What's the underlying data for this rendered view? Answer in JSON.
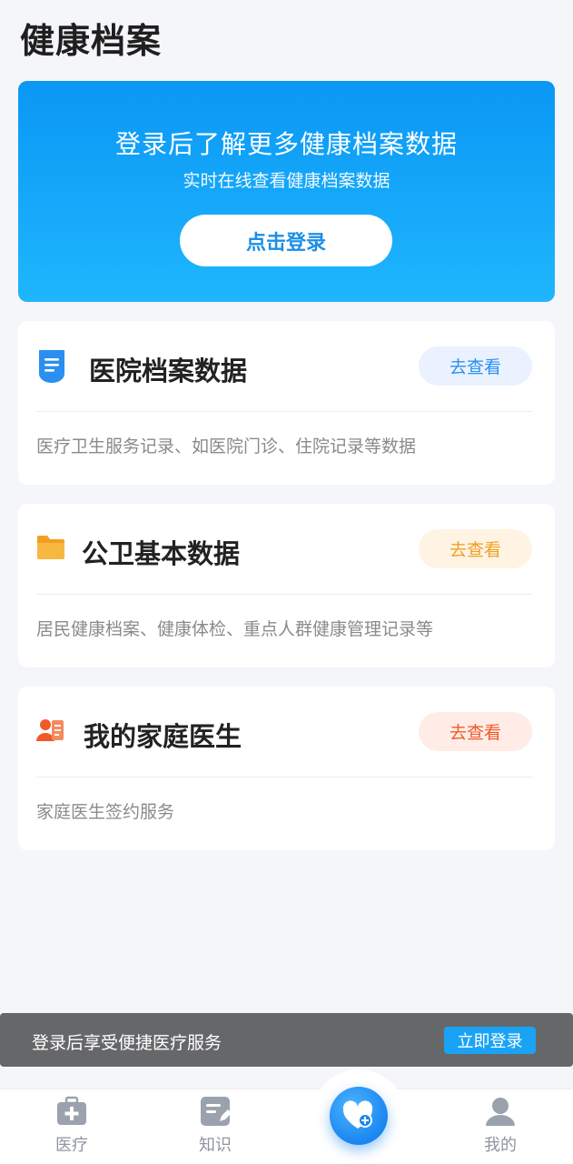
{
  "page": {
    "title": "健康档案"
  },
  "banner": {
    "title": "登录后了解更多健康档案数据",
    "subtitle": "实时在线查看健康档案数据",
    "button_label": "点击登录"
  },
  "cards": [
    {
      "title": "医院档案数据",
      "button_label": "去查看",
      "description": "医疗卫生服务记录、如医院门诊、住院记录等数据",
      "icon": "document-icon",
      "accent": "#2a8ff0",
      "button_bg": "#e9f2fe"
    },
    {
      "title": "公卫基本数据",
      "button_label": "去查看",
      "description": "居民健康档案、健康体检、重点人群健康管理记录等",
      "icon": "folder-icon",
      "accent": "#f0a020",
      "button_bg": "#fff3e3"
    },
    {
      "title": "我的家庭医生",
      "button_label": "去查看",
      "description": "家庭医生签约服务",
      "icon": "doctor-icon",
      "accent": "#f05a2a",
      "button_bg": "#ffece6"
    }
  ],
  "toast": {
    "text": "登录后享受便捷医疗服务",
    "button_label": "立即登录"
  },
  "tabbar": {
    "items": [
      {
        "label": "医疗",
        "icon": "medical-kit-icon"
      },
      {
        "label": "知识",
        "icon": "knowledge-icon"
      },
      {
        "label": "",
        "icon": "health-heart-icon"
      },
      {
        "label": "我的",
        "icon": "user-icon"
      }
    ]
  }
}
